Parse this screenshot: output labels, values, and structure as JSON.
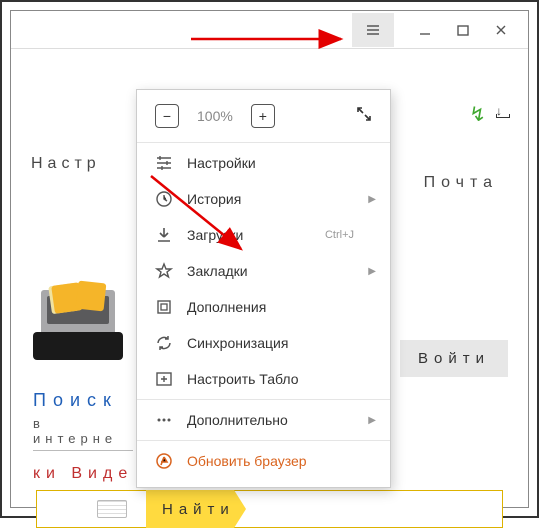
{
  "window": {
    "hamburger_name": "menu",
    "minimize": "–",
    "maximize": "□",
    "close": "×"
  },
  "zoom": {
    "minus": "−",
    "plus": "+",
    "level": "100%",
    "fullscreen": "⤢"
  },
  "menu": {
    "settings": "Настройки",
    "history": "История",
    "downloads": "Загрузки",
    "downloads_shortcut": "Ctrl+J",
    "bookmarks": "Закладки",
    "addons": "Дополнения",
    "sync": "Синхронизация",
    "configure_board": "Настроить Табло",
    "more": "Дополнительно",
    "update": "Обновить браузер"
  },
  "page": {
    "settings_heading": "Настр",
    "mail_heading": "Почта",
    "search_title": "Поиск",
    "search_sub": "в интерне",
    "tabs": "ки Виде",
    "find_button": "Найти",
    "login_button": "Войти"
  }
}
